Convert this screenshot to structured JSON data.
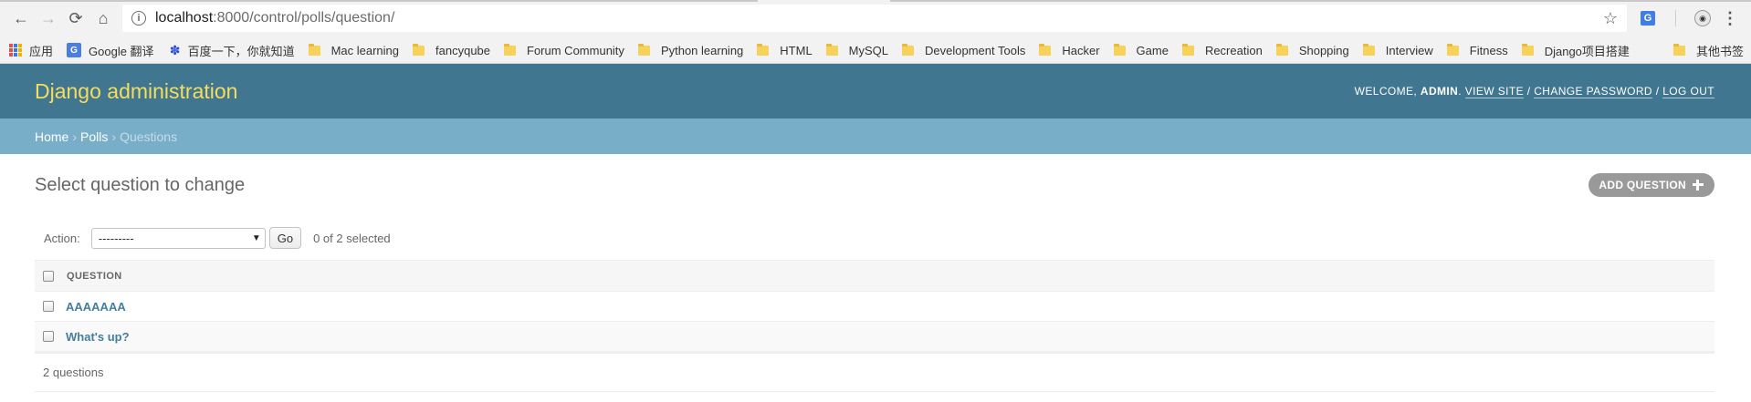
{
  "browser": {
    "url_host": "localhost",
    "url_path": ":8000/control/polls/question/",
    "bookmarks": [
      {
        "label": "应用",
        "icon": "apps-grid-icon"
      },
      {
        "label": "Google 翻译",
        "icon": "google-translate-icon"
      },
      {
        "label": "百度一下，你就知道",
        "icon": "baidu-paw-icon"
      },
      {
        "label": "Mac learning",
        "icon": "folder-icon"
      },
      {
        "label": "fancyqube",
        "icon": "folder-icon"
      },
      {
        "label": "Forum Community",
        "icon": "folder-icon"
      },
      {
        "label": "Python learning",
        "icon": "folder-icon"
      },
      {
        "label": "HTML",
        "icon": "folder-icon"
      },
      {
        "label": "MySQL",
        "icon": "folder-icon"
      },
      {
        "label": "Development Tools",
        "icon": "folder-icon"
      },
      {
        "label": "Hacker",
        "icon": "folder-icon"
      },
      {
        "label": "Game",
        "icon": "folder-icon"
      },
      {
        "label": "Recreation",
        "icon": "folder-icon"
      },
      {
        "label": "Shopping",
        "icon": "folder-icon"
      },
      {
        "label": "Interview",
        "icon": "folder-icon"
      },
      {
        "label": "Fitness",
        "icon": "folder-icon"
      },
      {
        "label": "Django项目搭建",
        "icon": "folder-icon"
      }
    ],
    "other_bookmarks": "其他书签"
  },
  "header": {
    "brand": "Django administration",
    "welcome": "WELCOME, ",
    "username": "ADMIN",
    "welcome_end": ". ",
    "view_site": "VIEW SITE",
    "slash1": " / ",
    "change_password": "CHANGE PASSWORD",
    "slash2": " / ",
    "log_out": "LOG OUT"
  },
  "breadcrumbs": {
    "home": "Home",
    "sep": "›",
    "polls": "Polls",
    "current": "Questions"
  },
  "content": {
    "title": "Select question to change",
    "add_button": "ADD QUESTION"
  },
  "actions": {
    "label": "Action:",
    "selected_option": "---------",
    "go": "Go",
    "counter": "0 of 2 selected"
  },
  "table": {
    "column_question": "QUESTION",
    "rows": [
      "AAAAAAA",
      "What's up?"
    ]
  },
  "paginator": {
    "count_text": "2 questions"
  },
  "colors": {
    "header_bg": "#417690",
    "breadcrumb_bg": "#79aec8",
    "brand_yellow": "#f5dd5d",
    "link_blue": "#447e9b"
  }
}
